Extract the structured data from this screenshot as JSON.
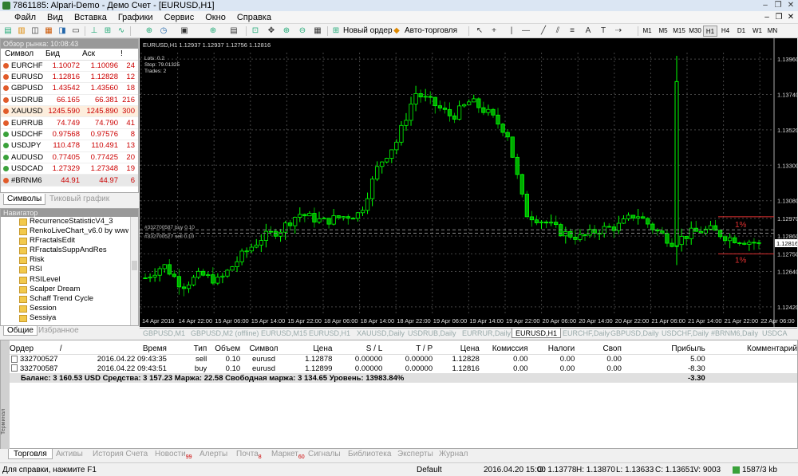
{
  "window": {
    "title": "7861185: Alpari-Demo - Демо Счет - [EURUSD,H1]",
    "minimize": "–",
    "restore": "❐",
    "close": "✕"
  },
  "menu": [
    "Файл",
    "Вид",
    "Вставка",
    "Графики",
    "Сервис",
    "Окно",
    "Справка"
  ],
  "toolbar": {
    "new_order": "Новый ордер",
    "auto_trading": "Авто-торговля",
    "timeframes": [
      "M1",
      "M5",
      "M15",
      "M30",
      "H1",
      "H4",
      "D1",
      "W1",
      "MN"
    ]
  },
  "market_watch": {
    "title": "Обзор рынка: 10:08:43",
    "columns": {
      "symbol": "Символ",
      "bid": "Бид",
      "ask": "Аск",
      "spread": "!"
    },
    "rows": [
      {
        "symbol": "EURCHF",
        "bid": "1.10072",
        "ask": "1.10096",
        "spread": "24",
        "dir": "up"
      },
      {
        "symbol": "EURUSD",
        "bid": "1.12816",
        "ask": "1.12828",
        "spread": "12",
        "dir": "up"
      },
      {
        "symbol": "GBPUSD",
        "bid": "1.43542",
        "ask": "1.43560",
        "spread": "18",
        "dir": "up"
      },
      {
        "symbol": "USDRUB",
        "bid": "66.165",
        "ask": "66.381",
        "spread": "216",
        "dir": "up"
      },
      {
        "symbol": "XAUUSD",
        "bid": "1245.590",
        "ask": "1245.890",
        "spread": "300",
        "dir": "up",
        "hl": true
      },
      {
        "symbol": "EURRUB",
        "bid": "74.749",
        "ask": "74.790",
        "spread": "41",
        "dir": "up"
      },
      {
        "symbol": "USDCHF",
        "bid": "0.97568",
        "ask": "0.97576",
        "spread": "8",
        "dir": "down"
      },
      {
        "symbol": "USDJPY",
        "bid": "110.478",
        "ask": "110.491",
        "spread": "13",
        "dir": "down"
      },
      {
        "symbol": "AUDUSD",
        "bid": "0.77405",
        "ask": "0.77425",
        "spread": "20",
        "dir": "down"
      },
      {
        "symbol": "USDCAD",
        "bid": "1.27329",
        "ask": "1.27348",
        "spread": "19",
        "dir": "down"
      },
      {
        "symbol": "#BRNM6",
        "bid": "44.91",
        "ask": "44.97",
        "spread": "6",
        "dir": "up",
        "dis": true
      }
    ],
    "tabs": [
      "Символы",
      "Тиковый график"
    ]
  },
  "navigator": {
    "title": "Навигатор",
    "items": [
      "RecurrenceStatisticV4_3",
      "RenkoLiveChart_v6.0 by www.",
      "RFractalsEdit",
      "RFractalsSuppAndRes",
      "Risk",
      "RSI",
      "RSILevel",
      "Scalper Dream",
      "Schaff Trend Cycle",
      "Session",
      "Sessiya"
    ],
    "tabs": [
      "Общие",
      "Избранное"
    ]
  },
  "chart": {
    "header": "EURUSD,H1  1.12937 1.12937 1.12756 1.12816",
    "info": [
      "Lots: 0.2",
      "Stop: 79.01325",
      "Trades: 2"
    ],
    "order_lines": [
      "#332700587 buy 0.10",
      "#332700527 sell 0.10"
    ],
    "pct_labels": [
      "1%",
      "1%"
    ],
    "price_levels": [
      "1.13960",
      "1.13740",
      "1.13520",
      "1.13300",
      "1.13080",
      "1.12970",
      "1.12860",
      "1.12750",
      "1.12640",
      "1.12420"
    ],
    "current_price": "1.12816",
    "time_labels": [
      "14 Apr 2016",
      "14 Apr 22:00",
      "15 Apr 06:00",
      "15 Apr 14:00",
      "15 Apr 22:00",
      "18 Apr 06:00",
      "18 Apr 14:00",
      "18 Apr 22:00",
      "19 Apr 06:00",
      "19 Apr 14:00",
      "19 Apr 22:00",
      "20 Apr 06:00",
      "20 Apr 14:00",
      "20 Apr 22:00",
      "21 Apr 06:00",
      "21 Apr 14:00",
      "21 Apr 22:00",
      "22 Apr 06:00"
    ],
    "colors": {
      "bull": "#00ff00",
      "bear": "#00aa00",
      "grid": "#2a2a2a",
      "order": "#888888"
    }
  },
  "chart_tabs": [
    "GBPUSD,M1",
    "GBPUSD,M2 (offline)",
    "EURUSD,M15",
    "EURUSD,H1",
    "XAUUSD,Daily",
    "USDRUB,Daily",
    "EURRUR,Daily",
    "EURUSD,H1",
    "EURCHF,Daily",
    "GBPUSD,Daily",
    "USDCHF,Daily",
    "#BRNM6,Daily",
    "USDCA"
  ],
  "terminal": {
    "columns": [
      "Ордер",
      "/",
      "Время",
      "Тип",
      "Объем",
      "Символ",
      "Цена",
      "S / L",
      "T / P",
      "Цена",
      "Комиссия",
      "Налоги",
      "Своп",
      "Прибыль",
      "Комментарий"
    ],
    "rows": [
      {
        "order": "332700527",
        "time": "2016.04.22 09:43:35",
        "type": "sell",
        "volume": "0.10",
        "symbol": "eurusd",
        "price": "1.12878",
        "sl": "0.00000",
        "tp": "0.00000",
        "cur": "1.12828",
        "commission": "0.00",
        "tax": "0.00",
        "swap": "0.00",
        "profit": "5.00"
      },
      {
        "order": "332700587",
        "time": "2016.04.22 09:43:51",
        "type": "buy",
        "volume": "0.10",
        "symbol": "eurusd",
        "price": "1.12899",
        "sl": "0.00000",
        "tp": "0.00000",
        "cur": "1.12816",
        "commission": "0.00",
        "tax": "0.00",
        "swap": "0.00",
        "profit": "-8.30"
      }
    ],
    "balance": "Баланс: 3 160.53 USD  Средства: 3 157.23  Маржа: 22.58  Свободная маржа: 3 134.65  Уровень: 13983.84%",
    "total": "-3.30",
    "side_label": "Терминал",
    "tabs": [
      {
        "label": "Торговля"
      },
      {
        "label": "Активы"
      },
      {
        "label": "История Счета"
      },
      {
        "label": "Новости",
        "badge": "99"
      },
      {
        "label": "Алерты"
      },
      {
        "label": "Почта",
        "badge": "8"
      },
      {
        "label": "Маркет",
        "badge": "60"
      },
      {
        "label": "Сигналы"
      },
      {
        "label": "Библиотека"
      },
      {
        "label": "Эксперты"
      },
      {
        "label": "Журнал"
      }
    ]
  },
  "status": {
    "help": "Для справки, нажмите F1",
    "profile": "Default",
    "datetime": "2016.04.20 15:00",
    "open": "O: 1.13778",
    "high": "H: 1.13870",
    "low": "L: 1.13633",
    "close": "C: 1.13651",
    "volume": "V: 9003",
    "traffic": "1587/3 kb"
  }
}
